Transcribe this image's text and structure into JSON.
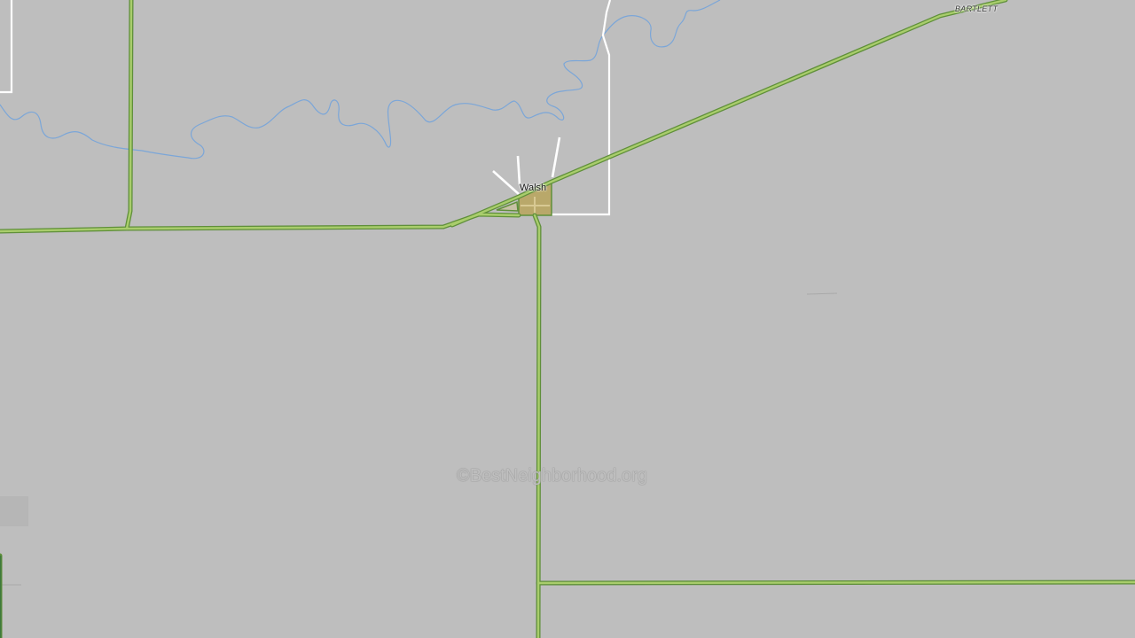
{
  "map": {
    "places": [
      {
        "name": "Walsh"
      },
      {
        "name": "BARTLETT"
      }
    ],
    "watermark": "©BestNeighborhood.org",
    "colors": {
      "land": "#bebebe",
      "road_outer": "#5f8f3a",
      "road_inner": "#a9cd6c",
      "water": "#7ba6d8",
      "boundary": "#ffffff",
      "urban_area": "#b9a86a"
    }
  }
}
